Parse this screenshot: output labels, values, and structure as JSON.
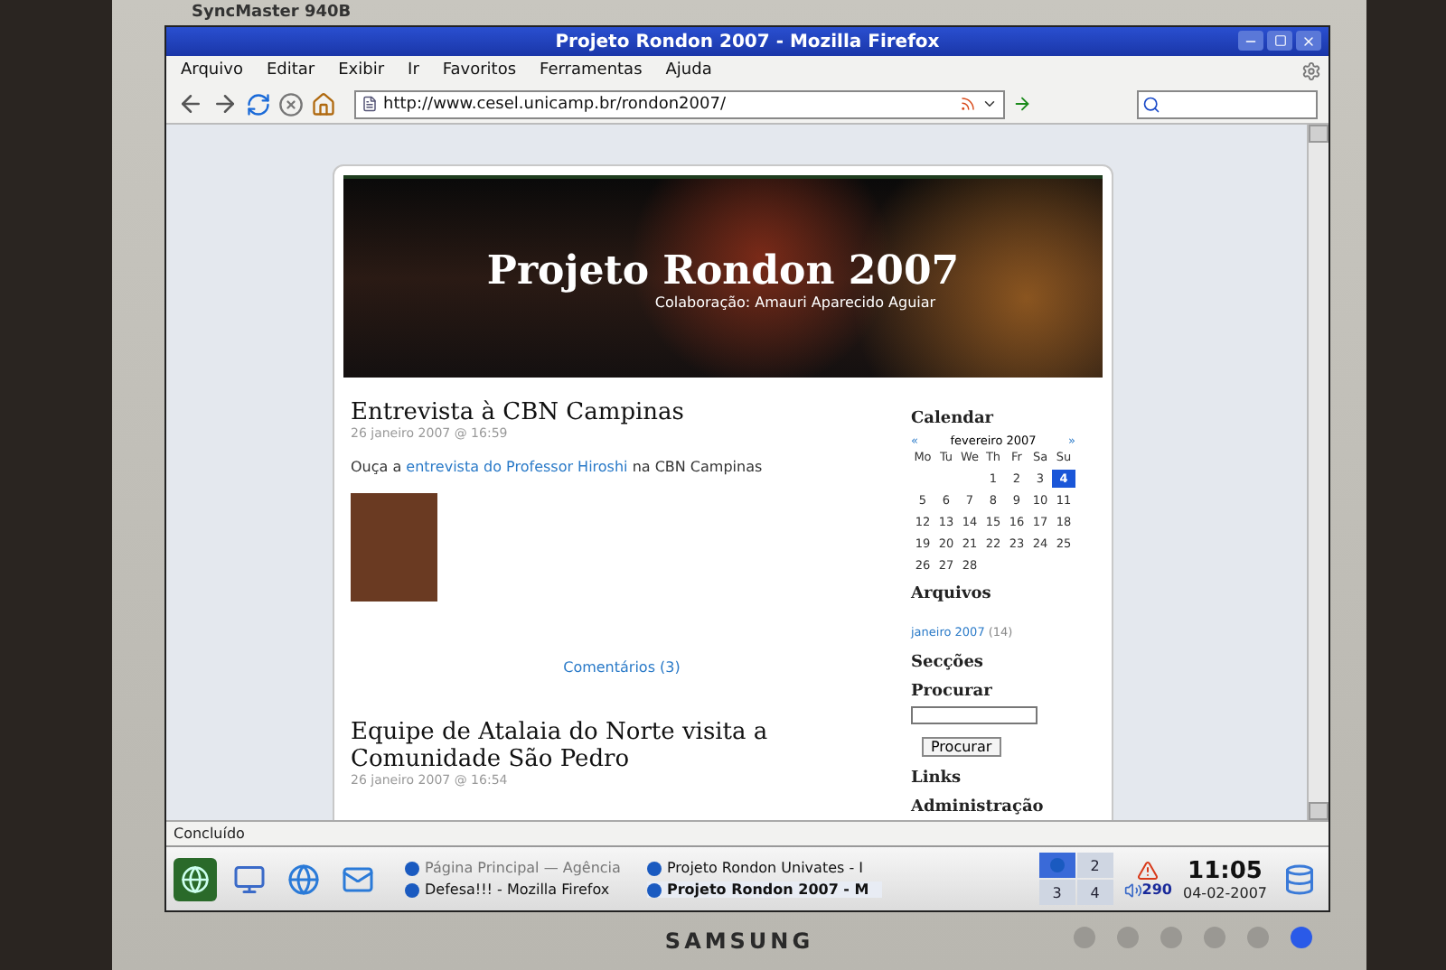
{
  "monitor": {
    "model": "SyncMaster 940B",
    "brand": "SAMSUNG"
  },
  "window": {
    "title": "Projeto Rondon 2007 - Mozilla Firefox"
  },
  "menu": [
    "Arquivo",
    "Editar",
    "Exibir",
    "Ir",
    "Favoritos",
    "Ferramentas",
    "Ajuda"
  ],
  "address": {
    "value": "http://www.cesel.unicamp.br/rondon2007/"
  },
  "blog": {
    "title": "Projeto Rondon 2007",
    "subtitle": "Colaboração: Amauri Aparecido Aguiar",
    "posts": [
      {
        "title": "Entrevista à CBN Campinas",
        "date": "26 janeiro 2007 @ 16:59",
        "text_before": "Ouça a",
        "link": "entrevista do Professor Hiroshi",
        "text_after": "na CBN Campinas",
        "comments": "Comentários (3)"
      },
      {
        "title": "Equipe de Atalaia do Norte visita a Comunidade São Pedro",
        "date": "26 janeiro 2007 @ 16:54"
      }
    ],
    "sidebar": {
      "calendar_heading": "Calendar",
      "prev": "«",
      "month": "fevereiro 2007",
      "next": "»",
      "weekdays": [
        "Mo",
        "Tu",
        "We",
        "Th",
        "Fr",
        "Sa",
        "Su"
      ],
      "weeks": [
        [
          {
            "label": "1",
            "selected": false
          },
          {
            "label": "2",
            "selected": false
          },
          {
            "label": "3",
            "selected": false
          },
          {
            "label": "4",
            "selected": true
          }
        ],
        [
          {
            "label": "5",
            "selected": false
          },
          {
            "label": "6",
            "selected": false
          },
          {
            "label": "7",
            "selected": false
          },
          {
            "label": "8",
            "selected": false
          },
          {
            "label": "9",
            "selected": false
          },
          {
            "label": "10",
            "selected": false
          },
          {
            "label": "11",
            "selected": false
          }
        ],
        [
          {
            "label": "12",
            "selected": false
          },
          {
            "label": "13",
            "selected": false
          },
          {
            "label": "14",
            "selected": false
          },
          {
            "label": "15",
            "selected": false
          },
          {
            "label": "16",
            "selected": false
          },
          {
            "label": "17",
            "selected": false
          },
          {
            "label": "18",
            "selected": false
          }
        ],
        [
          {
            "label": "19",
            "selected": false
          },
          {
            "label": "20",
            "selected": false
          },
          {
            "label": "21",
            "selected": false
          },
          {
            "label": "22",
            "selected": false
          },
          {
            "label": "23",
            "selected": false
          },
          {
            "label": "24",
            "selected": false
          },
          {
            "label": "25",
            "selected": false
          }
        ],
        [
          {
            "label": "26",
            "selected": false
          },
          {
            "label": "27",
            "selected": false
          },
          {
            "label": "28",
            "selected": false
          }
        ]
      ],
      "archives_heading": "Arquivos",
      "archive_link": "janeiro 2007",
      "archive_count": "(14)",
      "sections_heading": "Secções",
      "search_heading": "Procurar",
      "search_button": "Procurar",
      "links_heading": "Links",
      "admin_heading": "Administração"
    }
  },
  "status_bar": "Concluído",
  "taskbar": {
    "tasks": [
      {
        "label": "Página Principal — Agência",
        "active": false,
        "dim": true
      },
      {
        "label": "Projeto Rondon Univates - I",
        "active": false,
        "dim": false
      },
      {
        "label": "Defesa!!! - Mozilla Firefox",
        "active": false,
        "dim": false
      },
      {
        "label": "Projeto Rondon 2007 - M",
        "active": true,
        "dim": false
      }
    ],
    "pager": [
      {
        "selected": true
      },
      {
        "label": "2",
        "selected": false
      },
      {
        "label": "3",
        "selected": false
      },
      {
        "label": "4",
        "selected": false
      }
    ],
    "tray_count": "290",
    "time": "11:05",
    "date": "04-02-2007"
  }
}
